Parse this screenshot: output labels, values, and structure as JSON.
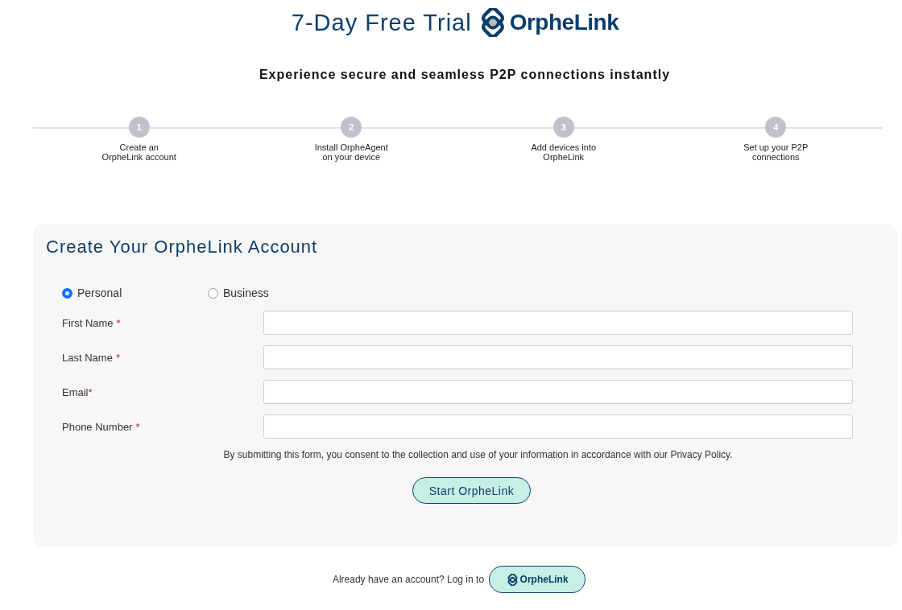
{
  "header": {
    "title": "7-Day Free Trial",
    "brand": "OrpheLink",
    "subtitle": "Experience secure and seamless P2P connections instantly"
  },
  "steps": [
    {
      "number": "1",
      "lines": [
        "Create an",
        "OrpheLink account"
      ]
    },
    {
      "number": "2",
      "lines": [
        "Install OrpheAgent",
        "on your device"
      ]
    },
    {
      "number": "3",
      "lines": [
        "Add devices into",
        "OrpheLink"
      ]
    },
    {
      "number": "4",
      "lines": [
        "Set up your P2P",
        "connections"
      ]
    }
  ],
  "form": {
    "title": "Create Your OrpheLink Account",
    "account_types": [
      {
        "label": "Personal",
        "selected": true
      },
      {
        "label": "Business",
        "selected": false
      }
    ],
    "fields": [
      {
        "label": "First Name",
        "mark": "*",
        "spaced": true
      },
      {
        "label": "Last Name",
        "mark": "*",
        "spaced": true
      },
      {
        "label": "Email",
        "mark": "*",
        "spaced": false
      },
      {
        "label": "Phone Number",
        "mark": "*",
        "spaced": true
      }
    ],
    "consent": "By submitting this form, you consent to the collection and use of your information in accordance with our Privacy Policy.",
    "submit": "Start OrpheLink"
  },
  "login": {
    "text": "Already have an account? Log in to",
    "brand": "OrpheLink"
  }
}
